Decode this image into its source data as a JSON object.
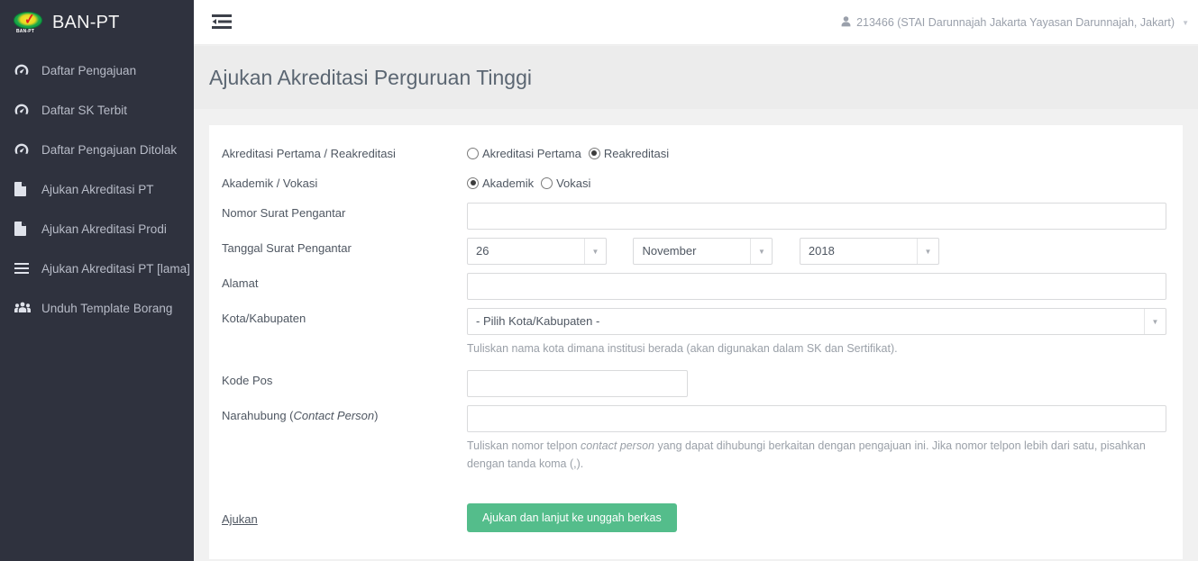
{
  "brand": {
    "title": "BAN-PT",
    "logo_text": "BAN-PT",
    "logo_icon": "ban-pt-oval-logo"
  },
  "sidebar": {
    "items": [
      {
        "label": "Daftar Pengajuan",
        "icon": "dashboard-icon"
      },
      {
        "label": "Daftar SK Terbit",
        "icon": "dashboard-icon"
      },
      {
        "label": "Daftar Pengajuan Ditolak",
        "icon": "dashboard-icon"
      },
      {
        "label": "Ajukan Akreditasi PT",
        "icon": "file-icon"
      },
      {
        "label": "Ajukan Akreditasi Prodi",
        "icon": "file-icon"
      },
      {
        "label": "Ajukan Akreditasi PT [lama]",
        "icon": "list-icon"
      },
      {
        "label": "Unduh Template Borang",
        "icon": "users-icon"
      }
    ]
  },
  "topbar": {
    "toggle_icon": "sidebar-collapse-icon",
    "user_icon": "user-icon",
    "user_label": "213466 (STAI Darunnajah Jakarta Yayasan Darunnajah, Jakart)",
    "caret_icon": "chevron-down-icon"
  },
  "page": {
    "title": "Ajukan Akreditasi Perguruan Tinggi"
  },
  "form": {
    "accreditation_type": {
      "label": "Akreditasi Pertama / Reakreditasi",
      "options": [
        {
          "label": "Akreditasi Pertama",
          "selected": false
        },
        {
          "label": "Reakreditasi",
          "selected": true
        }
      ]
    },
    "program_type": {
      "label": "Akademik / Vokasi",
      "options": [
        {
          "label": "Akademik",
          "selected": true
        },
        {
          "label": "Vokasi",
          "selected": false
        }
      ]
    },
    "letter_number": {
      "label": "Nomor Surat Pengantar",
      "value": "",
      "placeholder": ""
    },
    "letter_date": {
      "label": "Tanggal Surat Pengantar",
      "day": "26",
      "month": "November",
      "year": "2018"
    },
    "address": {
      "label": "Alamat",
      "value": "",
      "placeholder": ""
    },
    "city": {
      "label": "Kota/Kabupaten",
      "value": "- Pilih Kota/Kabupaten -",
      "help": "Tuliskan nama kota dimana institusi berada (akan digunakan dalam SK dan Sertifikat)."
    },
    "postal_code": {
      "label": "Kode Pos",
      "value": "",
      "placeholder": ""
    },
    "contact_person": {
      "label_main": "Narahubung (",
      "label_em": "Contact Person",
      "label_tail": ")",
      "value": "",
      "placeholder": "",
      "help_a": "Tuliskan nomor telpon ",
      "help_em": "contact person",
      "help_b": " yang dapat dihubungi berkaitan dengan pengajuan ini. Jika nomor telpon lebih dari satu, pisahkan dengan tanda koma (,)."
    },
    "submit": {
      "label": "Ajukan",
      "button": "Ajukan dan lanjut ke unggah berkas"
    }
  },
  "colors": {
    "sidebar_bg": "#2f323e",
    "accent_green": "#54bd8b",
    "page_header_bg": "#ececec",
    "content_bg": "#f1f1f1",
    "text_muted": "#9aa0a8"
  }
}
